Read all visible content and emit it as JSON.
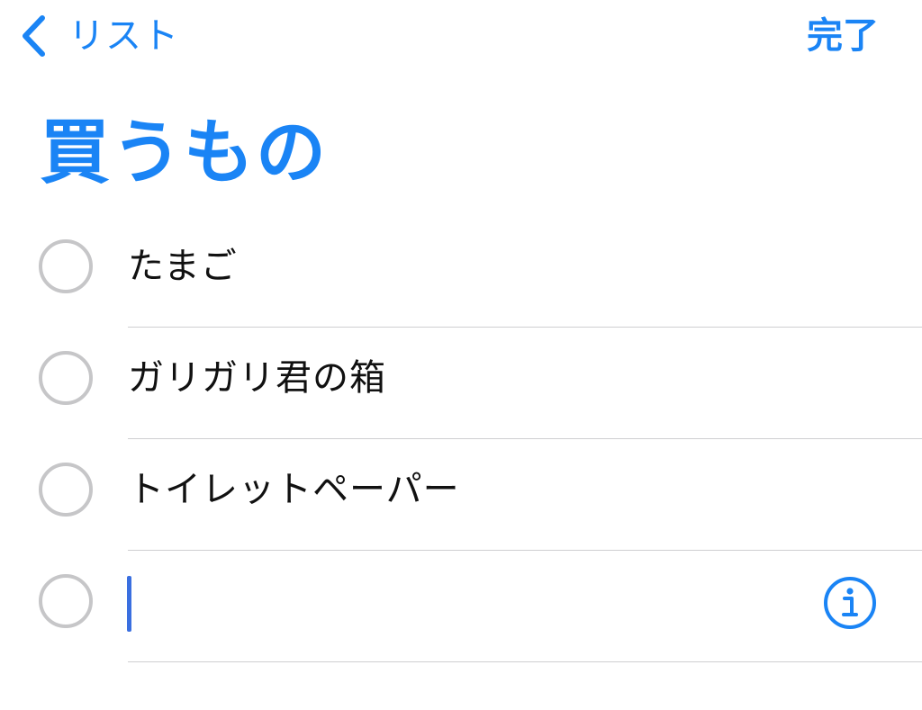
{
  "nav": {
    "back_label": "リスト",
    "done_label": "完了"
  },
  "list": {
    "title": "買うもの",
    "items": [
      {
        "text": "たまご",
        "completed": false
      },
      {
        "text": "ガリガリ君の箱",
        "completed": false
      },
      {
        "text": "トイレットペーパー",
        "completed": false
      }
    ],
    "new_item": {
      "value": "",
      "placeholder": ""
    }
  },
  "colors": {
    "accent": "#1a84f5",
    "text": "#111111",
    "circle": "#c6c6c8",
    "divider": "#cfcfd1",
    "cursor": "#3a6fe0"
  },
  "icons": {
    "back": "chevron-left-icon",
    "info": "info-icon"
  }
}
